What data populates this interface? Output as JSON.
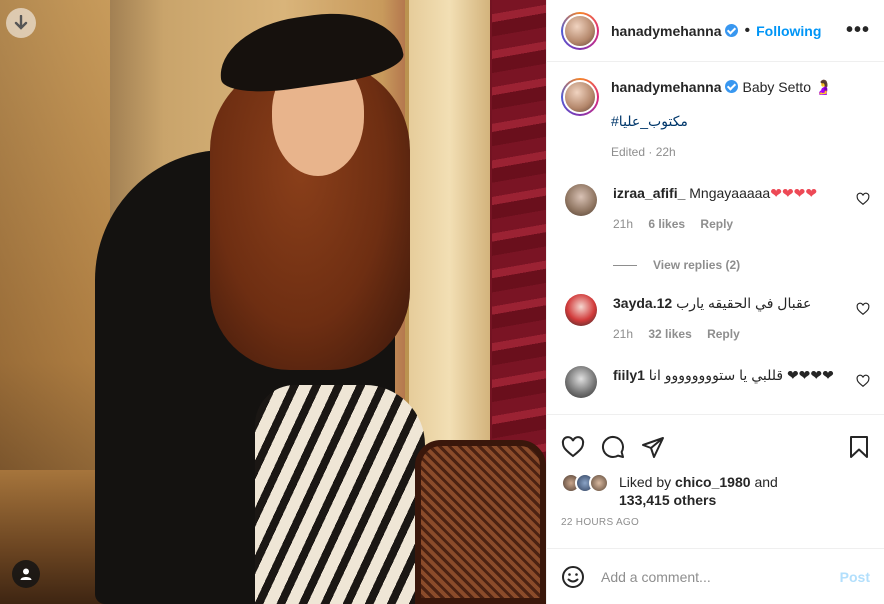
{
  "post": {
    "username": "hanadymehanna",
    "follow_state": "Following",
    "more_label": "•••",
    "caption_text": "Baby Setto 🤰",
    "hashtag": "#مكتوب_عليا",
    "caption_meta": "Edited · 22h"
  },
  "comments": [
    {
      "username": "izraa_afifi_",
      "text": "Mngayaaaaa",
      "emoji": "❤❤❤❤",
      "time": "21h",
      "likes": "6 likes",
      "reply_label": "Reply",
      "view_replies": "View replies (2)"
    },
    {
      "username": "3ayda.12",
      "text": "عقبال في الحقيقه يارب",
      "time": "21h",
      "likes": "32 likes",
      "reply_label": "Reply"
    },
    {
      "username": "fiily1",
      "text": "قللبي يا ستوووووووو انا ❤❤❤❤"
    }
  ],
  "likes": {
    "liked_by_prefix": "Liked by",
    "liked_by_user": "chico_1980",
    "and": "and",
    "others": "133,415 others"
  },
  "timestamp": "22 HOURS AGO",
  "comment_box": {
    "placeholder": "Add a comment...",
    "post_label": "Post"
  },
  "icons": {
    "photo_download": "arrow-down-icon",
    "tagged_users": "user-icon",
    "like": "heart-icon",
    "comment": "comment-icon",
    "share": "paper-plane-icon",
    "save": "bookmark-icon",
    "emoji": "smiley-icon"
  },
  "colors": {
    "accent": "#0095f6",
    "verified": "#3897f0",
    "post_disabled": "#b2dffc",
    "heart": "#ed4956"
  }
}
